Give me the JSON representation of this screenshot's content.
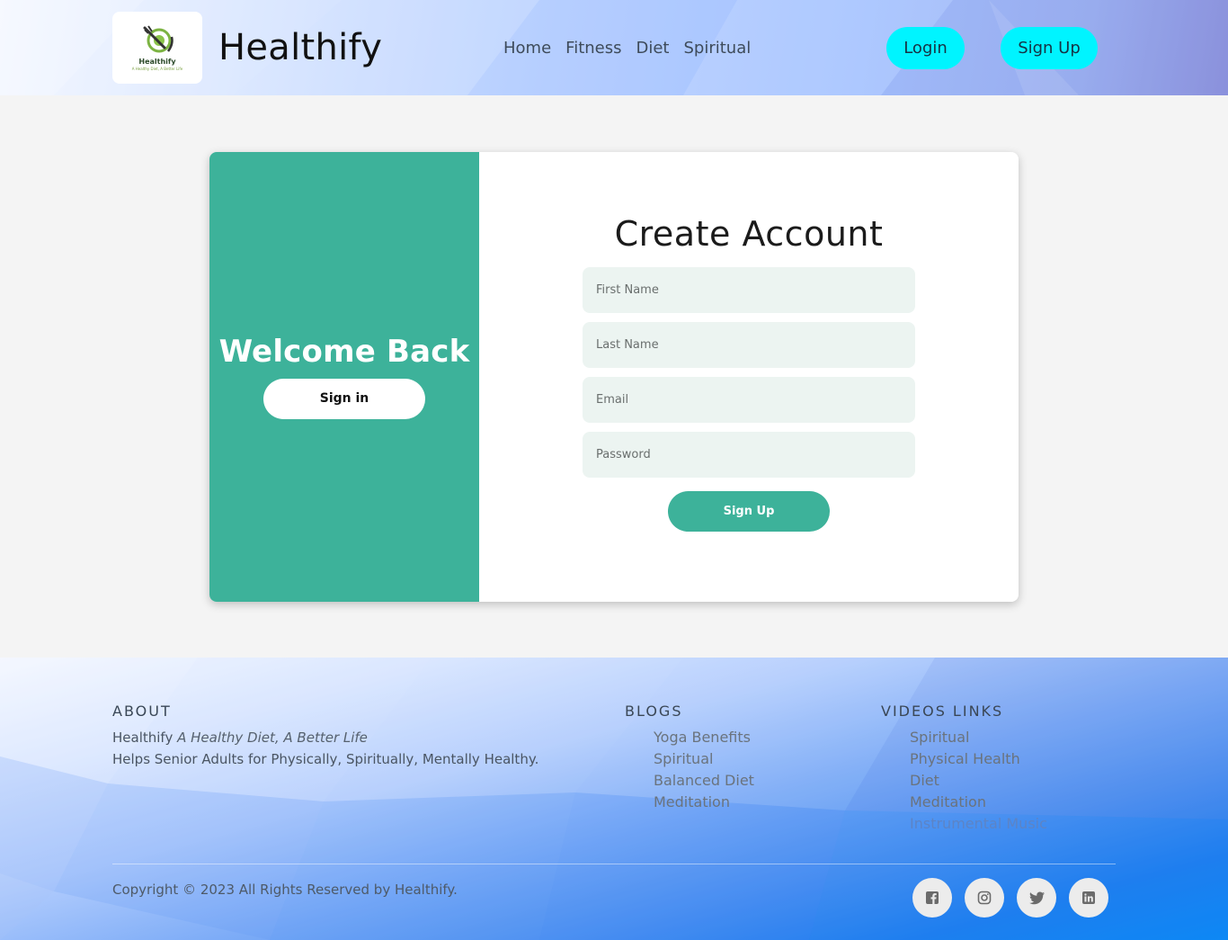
{
  "header": {
    "brand": "Healthify",
    "logo": {
      "word": "Healthify",
      "tagline": "A Healthy Diet, A Better Life"
    },
    "nav": [
      {
        "label": "Home"
      },
      {
        "label": "Fitness"
      },
      {
        "label": "Diet"
      },
      {
        "label": "Spiritual"
      }
    ],
    "login_label": "Login",
    "signup_label": "Sign Up"
  },
  "card": {
    "left": {
      "welcome": "Welcome Back",
      "signin_label": "Sign in"
    },
    "right": {
      "title": "Create Account",
      "fields": [
        {
          "placeholder": "First Name",
          "value": ""
        },
        {
          "placeholder": "Last Name",
          "value": ""
        },
        {
          "placeholder": "Email",
          "value": ""
        },
        {
          "placeholder": "Password",
          "value": ""
        }
      ],
      "submit_label": "Sign Up"
    },
    "accent_color": "#3db29a"
  },
  "footer": {
    "about": {
      "heading": "ABOUT",
      "brand": "Healthify",
      "tagline": "A Healthy Diet, A Better Life",
      "description": "Helps Senior Adults for Physically, Spiritually, Mentally Healthy."
    },
    "blogs": {
      "heading": "BLOGS",
      "items": [
        "Yoga Benefits",
        "Spiritual",
        "Balanced Diet",
        "Meditation"
      ]
    },
    "videos": {
      "heading": "VIDEOS LINKS",
      "items": [
        "Spiritual",
        "Physical Health",
        "Diet",
        "Meditation",
        "Instrumental Music"
      ]
    },
    "copyright": "Copyright © 2023 All Rights Reserved by  Healthify.",
    "social": [
      {
        "icon": "facebook-icon"
      },
      {
        "icon": "instagram-icon"
      },
      {
        "icon": "twitter-icon"
      },
      {
        "icon": "linkedin-icon"
      }
    ]
  },
  "colors": {
    "header_button": "#00f4ff",
    "card_accent": "#3db29a",
    "field_background": "#ecf4f1"
  }
}
